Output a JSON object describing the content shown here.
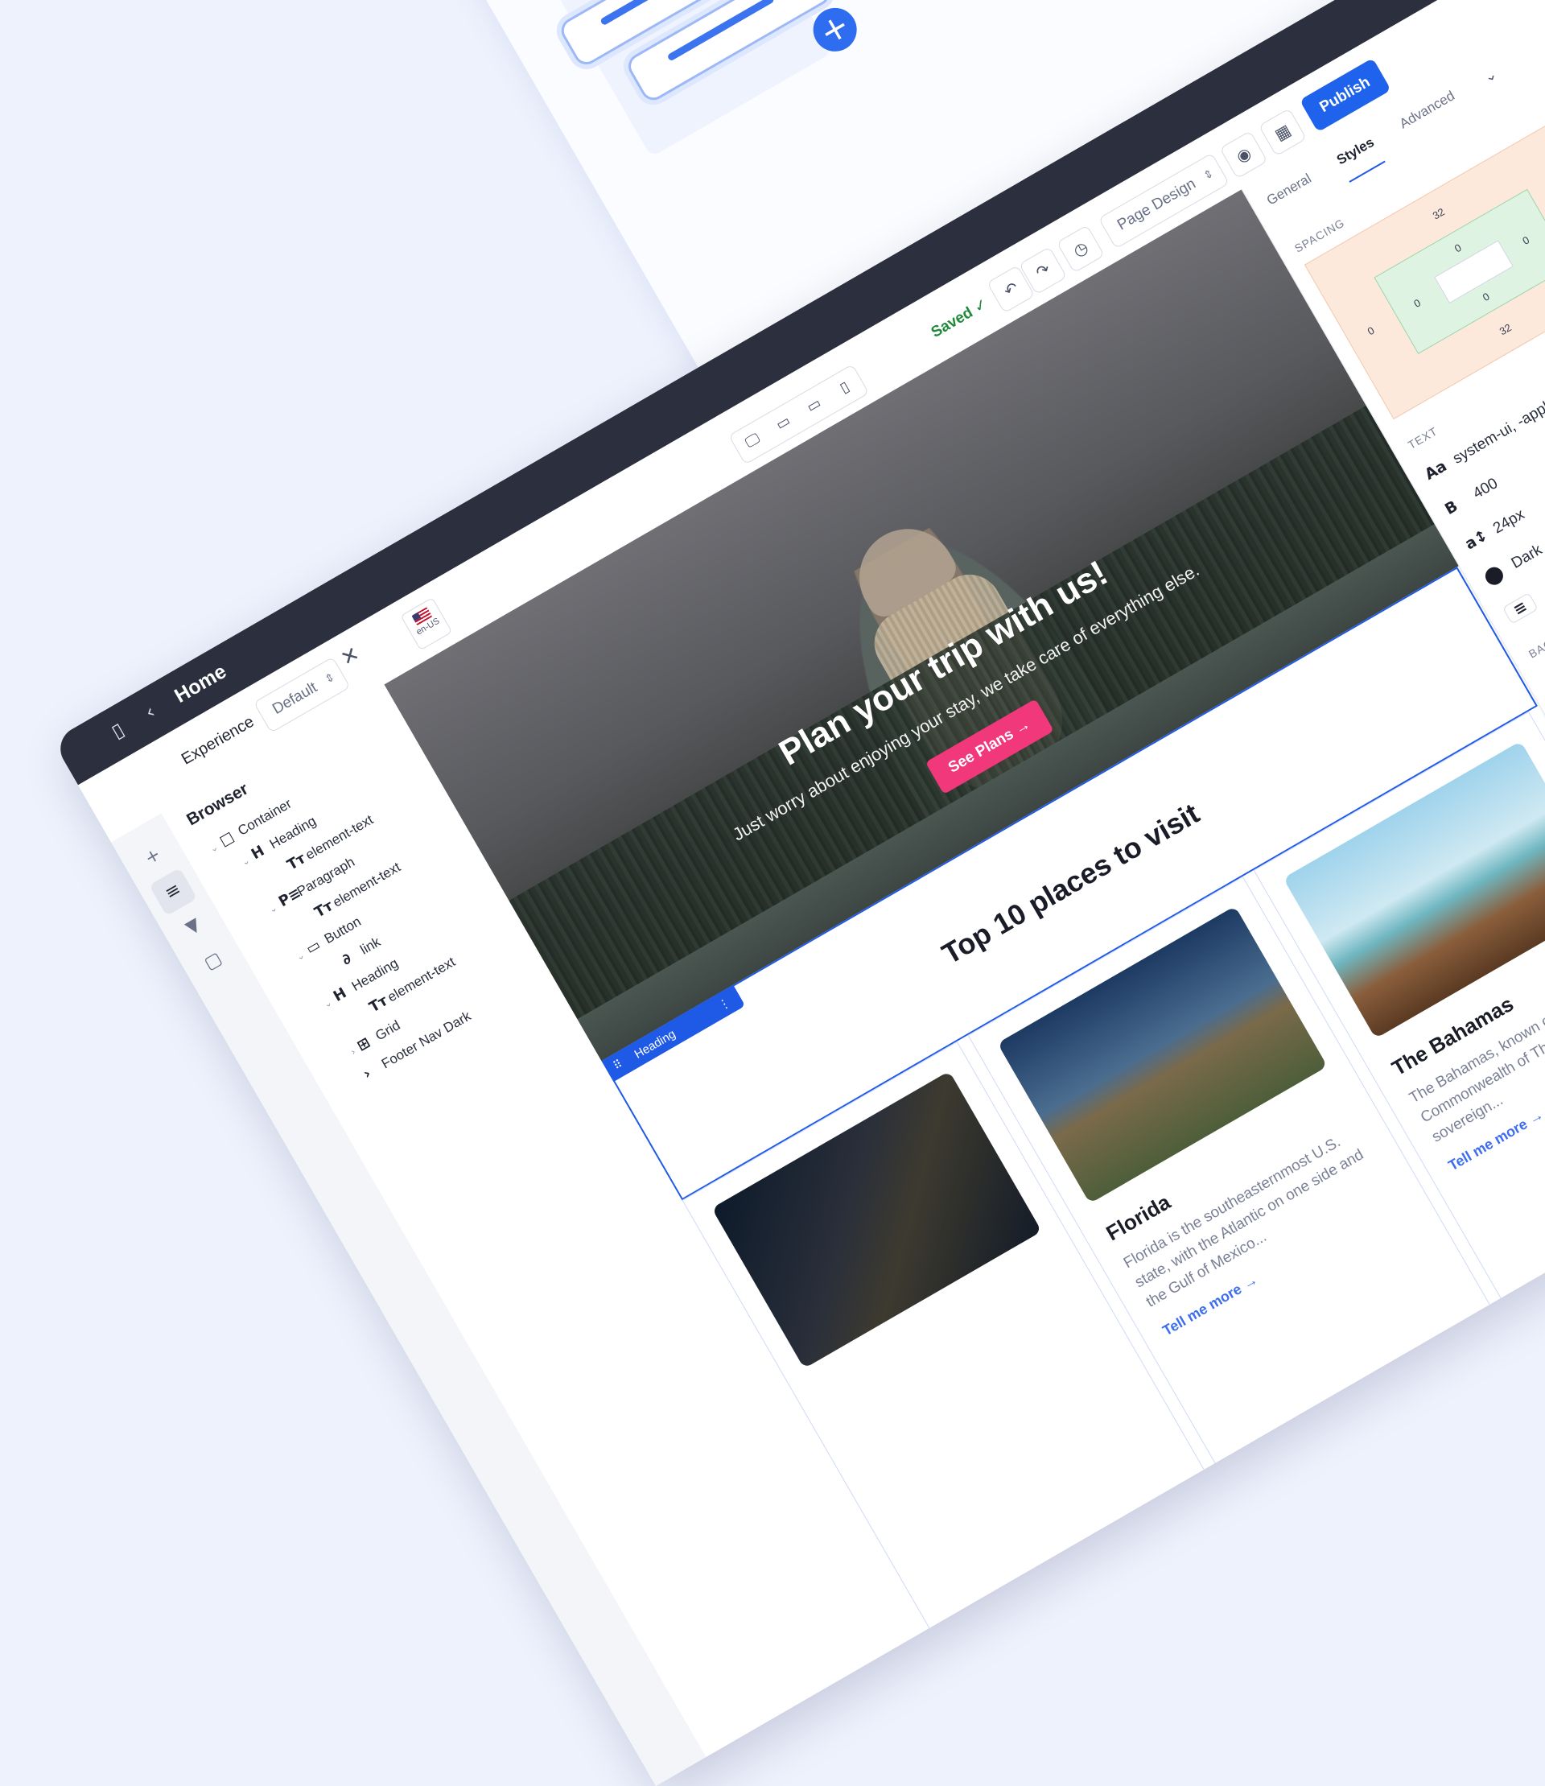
{
  "topbar": {
    "page_title": "Home",
    "back_icon": "‹",
    "panel_icon": "▯",
    "more_icon": "⋮"
  },
  "experience": {
    "label": "Experience",
    "selected": "Default",
    "locale": "en-US"
  },
  "status": {
    "saved_label": "Saved",
    "saved_icon": "✓"
  },
  "toolbar": {
    "undo_icon": "↶",
    "redo_icon": "↷",
    "history_icon": "◷",
    "page_design": "Page Design",
    "preview_icon": "◉",
    "save_icon": "▦",
    "publish_label": "Publish"
  },
  "devices": [
    "🖵",
    "▭",
    "▭",
    "▯"
  ],
  "rail": {
    "add_icon": "+",
    "layers_icon": "≡",
    "paint_icon": "▼",
    "comment_icon": "▢"
  },
  "browser": {
    "title": "Browser",
    "close_icon": "✕",
    "tree": [
      {
        "icon": "□",
        "label": "Container"
      },
      {
        "icon": "H",
        "label": "Heading"
      },
      {
        "icon": "Tт",
        "label": "element-text"
      },
      {
        "icon": "P≡",
        "label": "Paragraph"
      },
      {
        "icon": "Tт",
        "label": "element-text"
      },
      {
        "icon": "▭",
        "label": "Button"
      },
      {
        "icon": "∂",
        "label": "link"
      },
      {
        "icon": "H",
        "label": "Heading"
      },
      {
        "icon": "Tт",
        "label": "element-text"
      },
      {
        "icon": "⊞",
        "label": "Grid"
      },
      {
        "icon": "›",
        "label": "Footer Nav Dark"
      }
    ]
  },
  "hero": {
    "title": "Plan your trip with us!",
    "subtitle": "Just worry about enjoying your stay, we take care of everything else.",
    "button": "See Plans",
    "button_icon": "→"
  },
  "selection": {
    "tag": "Heading",
    "grip_icon": "⠿",
    "more_icon": "⋮"
  },
  "section": {
    "title": "Top 10 places to visit"
  },
  "cards": [
    {
      "title": "",
      "desc": "",
      "link": ""
    },
    {
      "title": "Florida",
      "desc": "Florida is the southeasternmost U.S. state, with the Atlantic on one side and the Gulf of Mexico...",
      "link": "Tell me more"
    },
    {
      "title": "The Bahamas",
      "desc": "The Bahamas, known officially as the Commonwealth of The Bahamas, is a sovereign...",
      "link": "Tell me more"
    }
  ],
  "card_link_icon": "→",
  "right_panel": {
    "tabs": [
      "General",
      "Styles",
      "Advanced"
    ],
    "active_tab": "Styles",
    "collapse_icon": "⌄",
    "spacing_label": "SPACING",
    "margin": {
      "top": "32",
      "bottom": "32",
      "left": "0",
      "right": "0"
    },
    "padding": {
      "top": "0",
      "bottom": "0",
      "left": "0",
      "right": "0"
    },
    "text_label": "TEXT",
    "font_family": "system-ui, -apple",
    "font_weight": "400",
    "font_size": "24px",
    "color": "Dark",
    "background_label": "BAC",
    "align_icon": "≡"
  },
  "colors": {
    "accent": "#1f63ed",
    "topbar": "#2c2f3e",
    "cta": "#f0387a",
    "saved": "#1f8a3a"
  }
}
